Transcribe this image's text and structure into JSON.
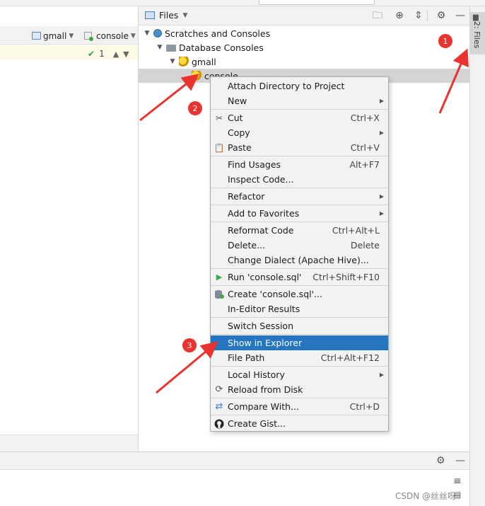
{
  "editor": {
    "datasource": "gmall",
    "console": "console",
    "check_count": "1"
  },
  "files_panel": {
    "title": "Files",
    "tree": [
      {
        "label": "Scratches and Consoles",
        "icon": "scratches-icon"
      },
      {
        "label": "Database Consoles",
        "icon": "folder-icon"
      },
      {
        "label": "gmall",
        "icon": "hive-datasource-icon"
      },
      {
        "label": "console",
        "icon": "hive-console-icon"
      }
    ],
    "side_tab": "2: Files"
  },
  "context_menu": {
    "items": {
      "attach_directory": {
        "label": "Attach Directory to Project"
      },
      "new": {
        "label": "New"
      },
      "cut": {
        "label": "Cut",
        "shortcut": "Ctrl+X",
        "icon": "scissors-icon"
      },
      "copy": {
        "label": "Copy"
      },
      "paste": {
        "label": "Paste",
        "shortcut": "Ctrl+V",
        "icon": "clipboard-icon"
      },
      "find_usages": {
        "label": "Find Usages",
        "shortcut": "Alt+F7"
      },
      "inspect_code": {
        "label": "Inspect Code..."
      },
      "refactor": {
        "label": "Refactor"
      },
      "add_to_favorites": {
        "label": "Add to Favorites"
      },
      "reformat_code": {
        "label": "Reformat Code",
        "shortcut": "Ctrl+Alt+L"
      },
      "delete": {
        "label": "Delete...",
        "shortcut": "Delete"
      },
      "change_dialect": {
        "label": "Change Dialect (Apache Hive)..."
      },
      "run": {
        "label": "Run 'console.sql'",
        "shortcut": "Ctrl+Shift+F10",
        "icon": "run-icon"
      },
      "create": {
        "label": "Create 'console.sql'...",
        "icon": "create-config-icon"
      },
      "in_editor_results": {
        "label": "In-Editor Results"
      },
      "switch_session": {
        "label": "Switch Session"
      },
      "show_in_explorer": {
        "label": "Show in Explorer",
        "selected": true
      },
      "file_path": {
        "label": "File Path",
        "shortcut": "Ctrl+Alt+F12"
      },
      "local_history": {
        "label": "Local History"
      },
      "reload_from_disk": {
        "label": "Reload from Disk",
        "icon": "reload-icon"
      },
      "compare_with": {
        "label": "Compare With...",
        "shortcut": "Ctrl+D",
        "icon": "compare-icon"
      },
      "create_gist": {
        "label": "Create Gist...",
        "icon": "github-icon"
      }
    }
  },
  "annotations": {
    "badges": [
      "1",
      "2",
      "3"
    ],
    "color": "#e8332e"
  },
  "colors": {
    "selection": "#2675bf",
    "menu_bg": "#f2f2f2",
    "tree_selected": "#d4d4d4"
  },
  "watermark": "CSDN @丝丝呀"
}
